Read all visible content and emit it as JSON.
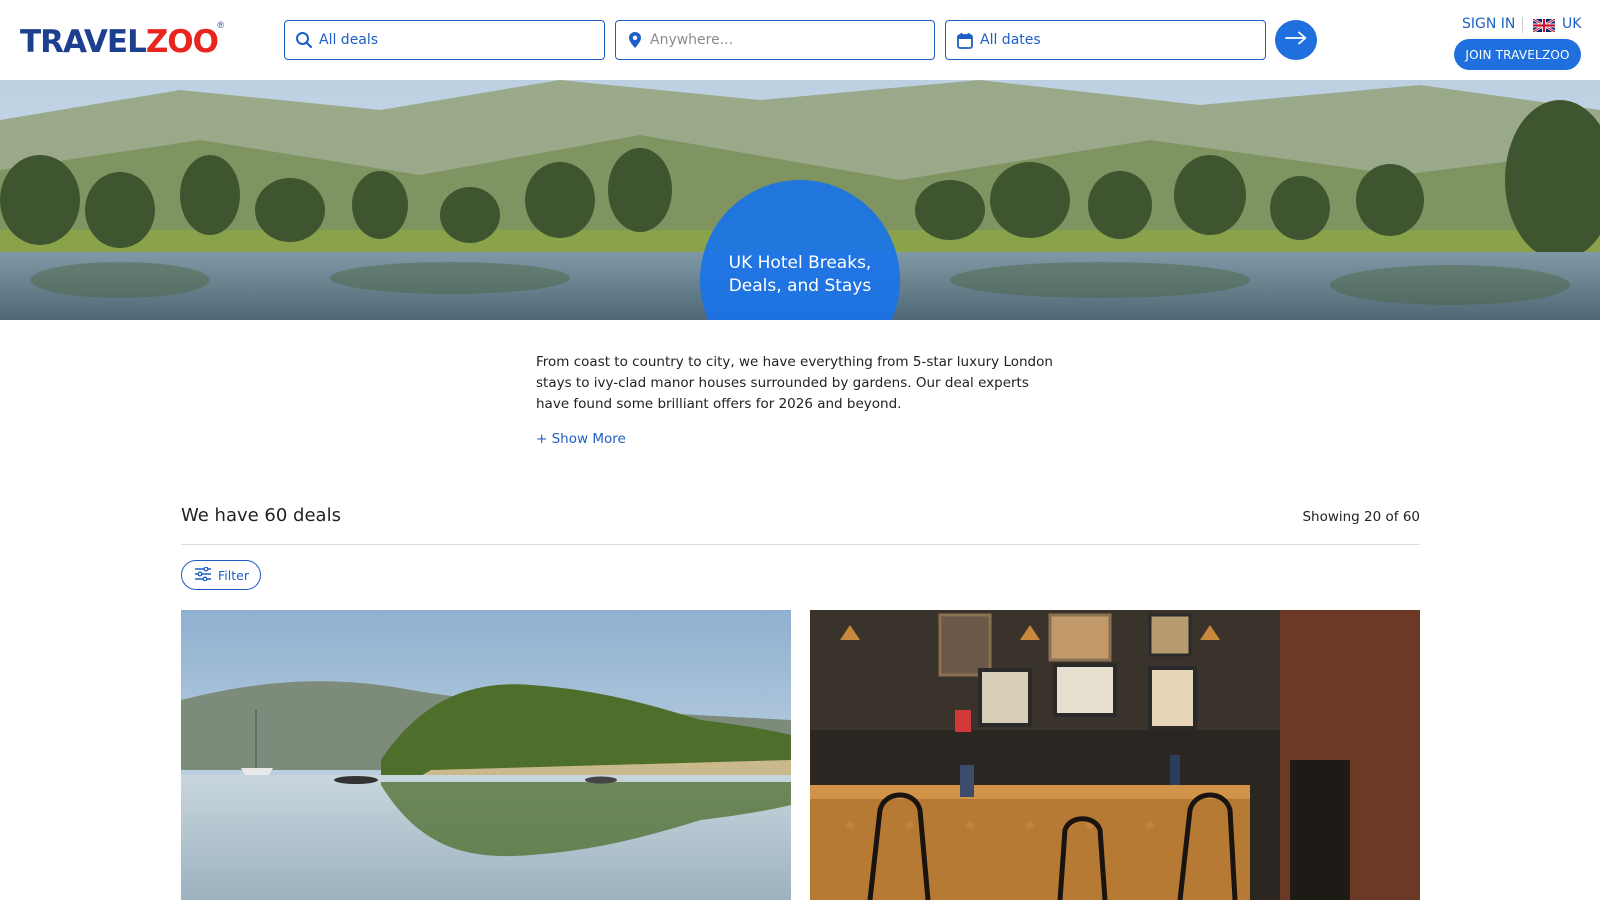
{
  "brand": {
    "logo_part1": "TRAVEL",
    "logo_part2": "ZOO",
    "logo_reg": "®",
    "primary_color": "#1f6fde",
    "logo_red": "#e8251f",
    "logo_blue": "#1d3f8f"
  },
  "search": {
    "deals_value": "All deals",
    "where_placeholder": "Anywhere...",
    "dates_value": "All dates"
  },
  "header": {
    "sign_in": "SIGN IN",
    "country": "UK",
    "join_label": "JOIN TRAVELZOO"
  },
  "hero": {
    "title": "UK Hotel Breaks, Deals, and Stays",
    "share_icons": [
      "facebook-icon",
      "x-icon",
      "email-icon"
    ]
  },
  "intro": {
    "text": "From coast to country to city, we have everything from 5-star luxury London stays to ivy-clad manor houses surrounded by gardens. Our deal experts have found some brilliant offers for 2026 and beyond.",
    "show_more": "+ Show More"
  },
  "results": {
    "heading": "We have 60 deals",
    "showing": "Showing 20 of 60",
    "filter_label": "Filter"
  },
  "cards": [
    {
      "image": "lake-reflection-image"
    },
    {
      "image": "pub-interior-image"
    }
  ]
}
